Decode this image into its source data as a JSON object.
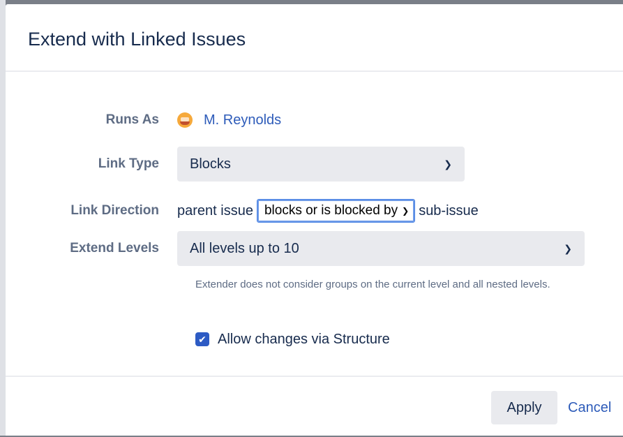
{
  "dialog": {
    "title": "Extend with Linked Issues"
  },
  "form": {
    "runs_as": {
      "label": "Runs As",
      "user": "M. Reynolds",
      "avatar_icon": "user-avatar-icon"
    },
    "link_type": {
      "label": "Link Type",
      "value": "Blocks"
    },
    "link_direction": {
      "label": "Link Direction",
      "prefix": "parent issue",
      "value": "blocks or is blocked by",
      "suffix": "sub-issue"
    },
    "extend_levels": {
      "label": "Extend Levels",
      "value": "All levels up to 10",
      "help": "Extender does not consider groups on the current level and all nested levels."
    },
    "allow_changes": {
      "label": "Allow changes via Structure",
      "checked": true
    }
  },
  "footer": {
    "apply_label": "Apply",
    "cancel_label": "Cancel"
  },
  "colors": {
    "link": "#2d5bb9",
    "checkbox": "#2d5bc4",
    "select_bg": "#e9eaee",
    "focus_border": "#6d9ae8"
  }
}
